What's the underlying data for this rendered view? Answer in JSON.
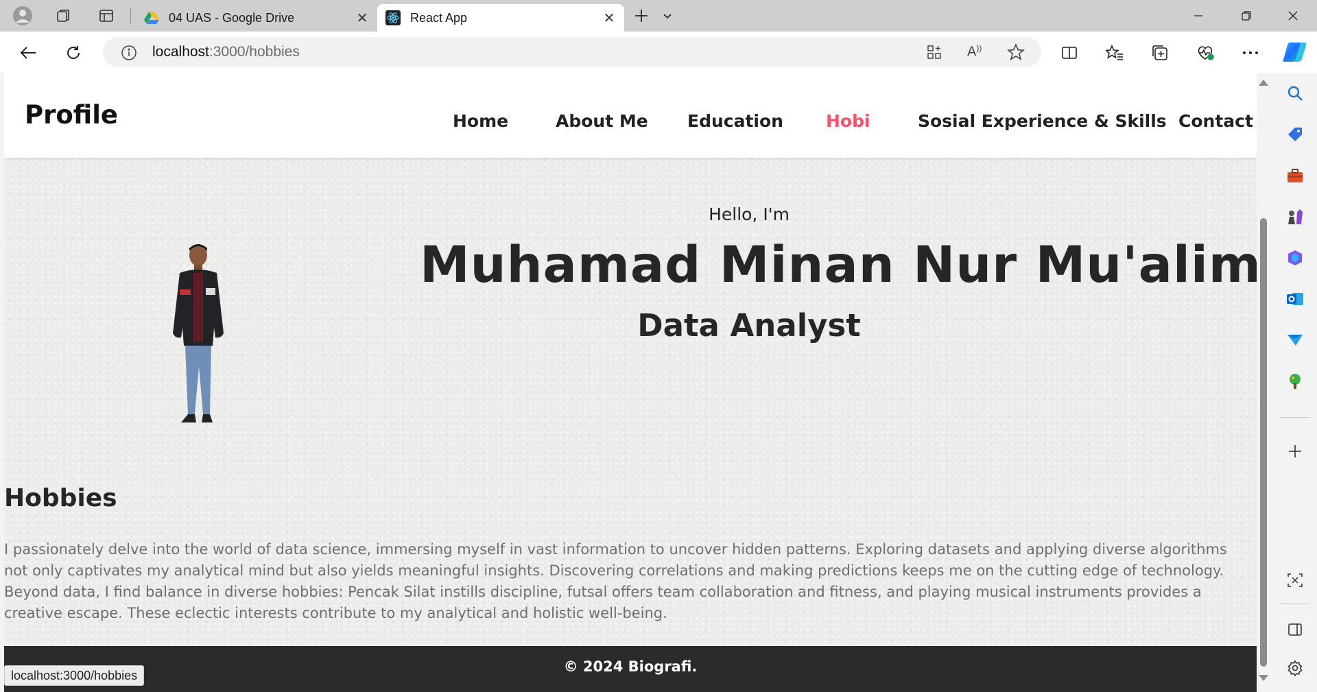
{
  "browser": {
    "tabs": [
      {
        "title": "04 UAS - Google Drive",
        "active": false,
        "icon": "google-drive-icon"
      },
      {
        "title": "React App",
        "active": true,
        "icon": "react-icon"
      }
    ],
    "url_host": "localhost",
    "url_path": ":3000/hobbies",
    "status_url": "localhost:3000/hobbies"
  },
  "site": {
    "brand": "Profile",
    "nav": [
      "Home",
      "About Me",
      "Education",
      "Hobi",
      "Sosial Experience & Skills",
      "Contact"
    ],
    "active_nav": "Hobi",
    "accent_color": "#f4546b"
  },
  "hero": {
    "greeting": "Hello, I'm",
    "name": "Muhamad Minan Nur Mu'alim",
    "role": "Data Analyst"
  },
  "hobbies": {
    "title": "Hobbies",
    "text": "I passionately delve into the world of data science, immersing myself in vast information to uncover hidden patterns. Exploring datasets and applying diverse algorithms not only captivates my analytical mind but also yields meaningful insights. Discovering correlations and making predictions keeps me on the cutting edge of technology. Beyond data, I find balance in diverse hobbies: Pencak Silat instills discipline, futsal offers team collaboration and fitness, and playing musical instruments provides a creative escape. These eclectic interests contribute to my analytical and holistic well-being."
  },
  "footer": {
    "text": "© 2024 Biografi."
  }
}
